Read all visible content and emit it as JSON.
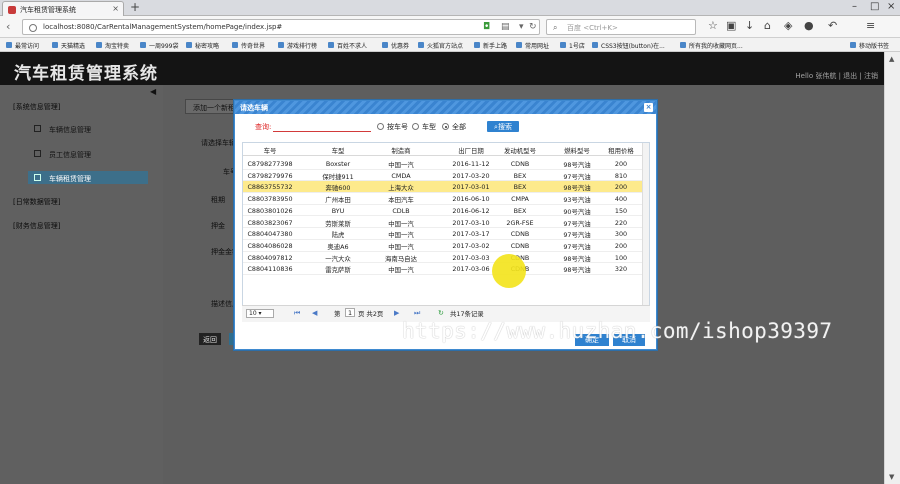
{
  "browser": {
    "tab_title": "汽车租赁管理系统",
    "url": "localhost:8080/CarRentalManagementSystem/homePage/index.jsp#",
    "search_placeholder": "百度 <Ctrl+K>",
    "bookmarks": [
      "最常访问",
      "天猫精选",
      "淘宝特卖",
      "一周999袋",
      "秘密攻略",
      "传奇世界",
      "游戏排行榜",
      "百姓不求人",
      "优惠券",
      "火狐官方站点",
      "新手上路",
      "常用网址",
      "1号店",
      "CSS3按钮(button)在...",
      "所有我的收藏网页...",
      "移动版书签"
    ]
  },
  "app": {
    "title": "汽车租赁管理系统",
    "user_links": "Hello 张伟航 | 退出 | 注销"
  },
  "sidebar": {
    "groups": [
      {
        "label": "[系统信息管理]"
      },
      {
        "label": "[日常数据管理]"
      },
      {
        "label": "[财务信息管理]"
      }
    ],
    "items": [
      {
        "label": "车辆信息管理"
      },
      {
        "label": "员工信息管理"
      },
      {
        "label": "车辆租赁管理"
      }
    ]
  },
  "content": {
    "tab_label": "添加一个新租赁",
    "form_labels": [
      "请选择车辆",
      "车号",
      "租期",
      "押金",
      "押金金额",
      "描述信息"
    ],
    "return_button": "返回"
  },
  "dialog": {
    "title": "请选车辆",
    "query_label": "查询:",
    "query_value": "",
    "radio_options": [
      {
        "label": "按车号",
        "selected": false
      },
      {
        "label": "车型",
        "selected": false
      },
      {
        "label": "全部",
        "selected": true
      }
    ],
    "search_button": "搜索",
    "columns": [
      "车号",
      "车型",
      "制造商",
      "出厂日期",
      "发动机型号",
      "燃料型号",
      "租用价格"
    ],
    "rows": [
      [
        "C8798277398",
        "Boxster",
        "中国一汽",
        "2016-11-12",
        "CDNB",
        "98号汽油",
        "200"
      ],
      [
        "C8798279976",
        "保时捷911",
        "CMDA",
        "2017-03-20",
        "BEX",
        "97号汽油",
        "810"
      ],
      [
        "C8863755732",
        "奔驰600",
        "上海大众",
        "2017-03-01",
        "BEX",
        "98号汽油",
        "200"
      ],
      [
        "C8803783950",
        "广州本田",
        "本田汽车",
        "2016-06-10",
        "CMPA",
        "93号汽油",
        "400"
      ],
      [
        "C8803801026",
        "BYU",
        "CDLB",
        "2016-06-12",
        "BEX",
        "90号汽油",
        "150"
      ],
      [
        "C8803823067",
        "劳斯莱斯",
        "中国一汽",
        "2017-03-10",
        "2GR-FSE",
        "97号汽油",
        "220"
      ],
      [
        "C8804047380",
        "陆虎",
        "中国一汽",
        "2017-03-17",
        "CDNB",
        "97号汽油",
        "300"
      ],
      [
        "C8804086028",
        "奥迪A6",
        "中国一汽",
        "2017-03-02",
        "CDNB",
        "97号汽油",
        "200"
      ],
      [
        "C8804097812",
        "一汽大众",
        "海南马自达",
        "2017-03-03",
        "CDNB",
        "98号汽油",
        "100"
      ],
      [
        "C8804110836",
        "雷克萨斯",
        "中国一汽",
        "2017-03-06",
        "CDNB",
        "98号汽油",
        "320"
      ]
    ],
    "selected_row": 2,
    "pager": {
      "page_size": "10",
      "page_label": "第",
      "page_value": "1",
      "page_total": "页 共2页",
      "total_text": "共17条记录"
    },
    "ok_button": "确定",
    "cancel_button": "取消"
  },
  "watermark": "https://www.huzhan.com/ishop39397"
}
